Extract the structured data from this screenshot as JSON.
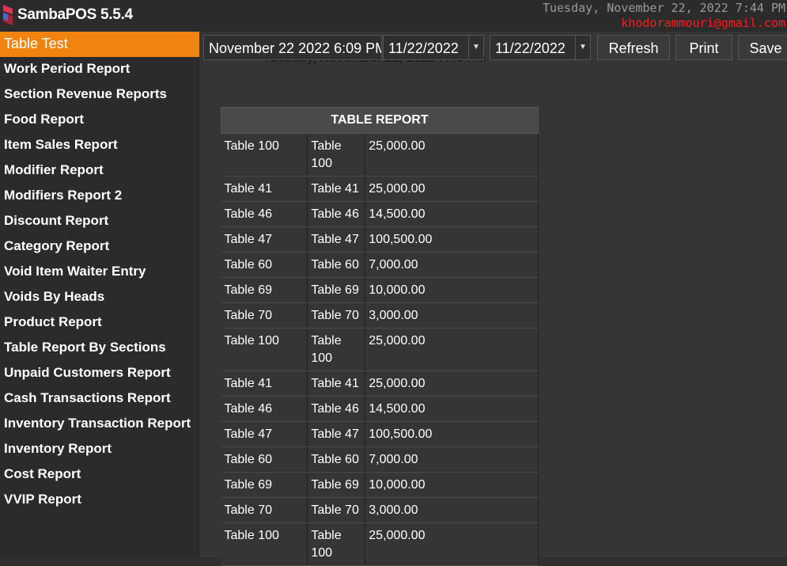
{
  "app": {
    "title": "SambaPOS 5.5.4",
    "clock": "Tuesday, November 22, 2022 7:44 PM",
    "email": "khodorammouri@gmail.com"
  },
  "sidebar": {
    "items": [
      {
        "label": "Table Test",
        "active": true
      },
      {
        "label": "Work Period Report"
      },
      {
        "label": "Section Revenue Reports"
      },
      {
        "label": "Food Report"
      },
      {
        "label": "Item Sales Report"
      },
      {
        "label": "Modifier Report"
      },
      {
        "label": "Modifiers Report 2"
      },
      {
        "label": "Discount Report"
      },
      {
        "label": "Category Report"
      },
      {
        "label": "Void Item Waiter Entry"
      },
      {
        "label": "Voids By Heads"
      },
      {
        "label": "Product Report"
      },
      {
        "label": "Table Report By Sections"
      },
      {
        "label": "Unpaid Customers Report"
      },
      {
        "label": "Cash Transactions Report"
      },
      {
        "label": "Inventory Transaction Report"
      },
      {
        "label": "Inventory Report"
      },
      {
        "label": "Cost Report"
      },
      {
        "label": "VVIP Report"
      }
    ]
  },
  "toolbar": {
    "period": "November 22 2022 6:09 PM",
    "start_date": "11/22/2022",
    "end_date": "11/22/2022",
    "refresh": "Refresh",
    "print": "Print",
    "save": "Save"
  },
  "report": {
    "header_text": "Tuesday, November 22, 2022 7:43 PM",
    "title": "TABLE REPORT",
    "rows": [
      [
        "Table 100",
        "Table 100",
        "25,000.00"
      ],
      [
        "Table 41",
        "Table 41",
        "25,000.00"
      ],
      [
        "Table 46",
        "Table 46",
        "14,500.00"
      ],
      [
        "Table 47",
        "Table 47",
        "100,500.00"
      ],
      [
        "Table 60",
        "Table 60",
        "7,000.00"
      ],
      [
        "Table 69",
        "Table 69",
        "10,000.00"
      ],
      [
        "Table 70",
        "Table 70",
        "3,000.00"
      ],
      [
        "Table 100",
        "Table 100",
        "25,000.00"
      ],
      [
        "Table 41",
        "Table 41",
        "25,000.00"
      ],
      [
        "Table 46",
        "Table 46",
        "14,500.00"
      ],
      [
        "Table 47",
        "Table 47",
        "100,500.00"
      ],
      [
        "Table 60",
        "Table 60",
        "7,000.00"
      ],
      [
        "Table 69",
        "Table 69",
        "10,000.00"
      ],
      [
        "Table 70",
        "Table 70",
        "3,000.00"
      ],
      [
        "Table 100",
        "Table 100",
        "25,000.00"
      ]
    ]
  },
  "colors": {
    "accent": "#f0840f",
    "email": "#ff1a1a",
    "background": "#2f2f2f"
  },
  "icons": {
    "logo": "sambapos-logo-icon",
    "dropdown": "chevron-down-icon"
  }
}
